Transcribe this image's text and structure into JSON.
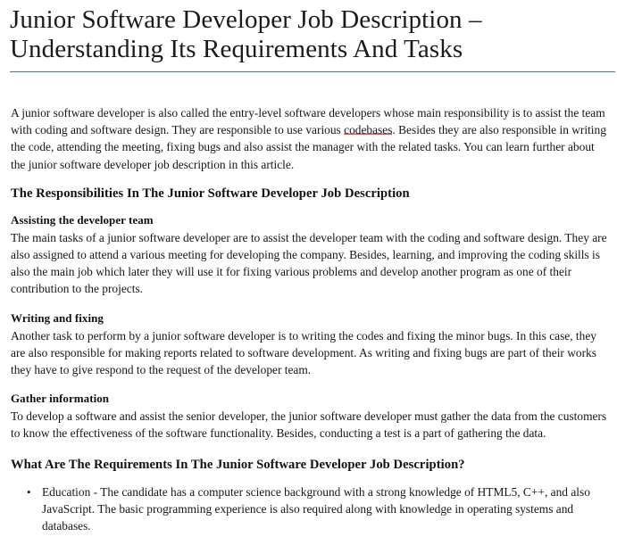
{
  "document": {
    "title": "Junior Software Developer Job Description – Understanding Its Requirements And Tasks",
    "title_line_1": "Junior Software Developer Job Description –",
    "title_line_2": "Understanding Its Requirements And Tasks",
    "rule_color": "#4f7386",
    "text_color": "#161616",
    "background_color": "#ffffff",
    "spellcheck_underline_color": "#d11a1a"
  },
  "intro": {
    "paragraph_part_1": "A junior software developer is also called the entry-level software developers whose main responsibility is to assist the team with coding and software design. They are responsible to use various ",
    "misspelled_word": "codebases",
    "paragraph_part_2": ". Besides they are also responsible in writing the code, attending the meeting, fixing bugs and also assist the manager with the related tasks. You can learn further about the junior software developer job description in this article."
  },
  "responsibilities_section": {
    "heading": "The Responsibilities In The Junior Software Developer Job Description",
    "subsections": [
      {
        "heading": "Assisting the developer team",
        "body": "The main tasks of a junior software developer are to assist the developer team with the coding and software design. They are also assigned to attend a various meeting for developing the company. Besides, learning, and improving the coding skills is also the main job which later they will use it for fixing various problems and develop another program as one of their contribution to the projects."
      },
      {
        "heading": "Writing and fixing",
        "body": "Another task to perform by a junior software developer is to writing the codes and fixing the minor bugs. In this case, they are also responsible for making reports related to software development. As writing and fixing bugs are part of their works they have to give respond to the request of the developer team."
      },
      {
        "heading": "Gather information",
        "body": "To develop a software and assist the senior developer, the junior software developer must gather the data from the customers to know the effectiveness of the software functionality. Besides, conducting a test is a part of gathering the data."
      }
    ]
  },
  "requirements_section": {
    "heading": "What Are The Requirements In The Junior Software Developer Job Description?",
    "bullet_marker": "•",
    "items": [
      "Education - The candidate has a computer science background with a strong knowledge of HTML5, C++, and also JavaScript. The basic programming experience is also required along with knowledge in operating systems and databases."
    ]
  }
}
